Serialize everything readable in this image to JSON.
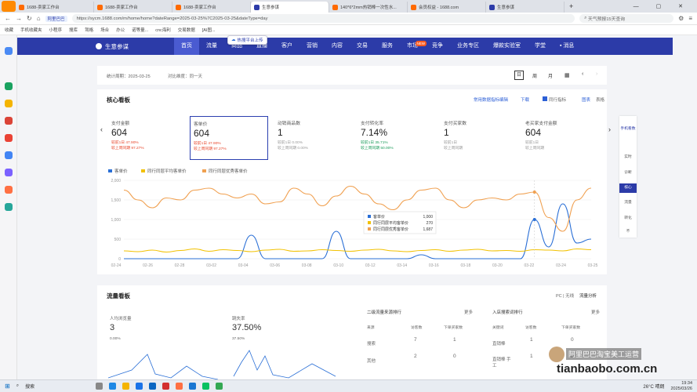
{
  "tabs": [
    {
      "label": "1688-卖家工作台",
      "color": "#ff6a00"
    },
    {
      "label": "1688-卖家工作台",
      "color": "#ff6a00"
    },
    {
      "label": "1688-卖家工作台",
      "color": "#ff6a00"
    },
    {
      "label": "生意参谋",
      "color": "#2c3ba8"
    },
    {
      "label": "140*6*2mm热销棒一次性水...",
      "color": "#ff6a00"
    },
    {
      "label": "会员权益 - 1688.com",
      "color": "#ff6a00"
    },
    {
      "label": "生意参谋",
      "color": "#2c3ba8"
    }
  ],
  "browser": {
    "url": "https://sycm.1688.com/m/home/home?dateRange=2025-03-25%7C2025-03-25&dateType=day",
    "search": "天气预报15天查询"
  },
  "bookmarks": [
    "收藏",
    "手机收藏夹",
    "小程序",
    "搜库",
    "驾格",
    "场合",
    "办公",
    "诺等量...",
    "cnc海利",
    "交易数据",
    "[AI图..."
  ],
  "appnav": {
    "brand": "生意参谋",
    "items": [
      "首页",
      "流量",
      "商品",
      "直播",
      "客户",
      "营销",
      "内容",
      "交易",
      "服务",
      "市场",
      "竞争",
      "业务专区",
      "爆款实验室",
      "学堂"
    ],
    "market_badge": "NEW",
    "msg": "消息"
  },
  "tooltip": "热搜平台上传",
  "filter": {
    "period": "统计周期：2025-03-25",
    "compare": "对比维度：同一天",
    "btns": [
      "日",
      "周",
      "月"
    ]
  },
  "core": {
    "title": "核心看板",
    "links": [
      "常用数据指标编辑",
      "下载",
      "同行指标",
      "图表",
      "表格"
    ],
    "metrics": [
      {
        "label": "支付金额",
        "value": "604",
        "l1": "较前1日 47.90%",
        "l2": "较上周同期 97.27%"
      },
      {
        "label": "客单价",
        "value": "604",
        "l1": "较前1日 47.90%",
        "l2": "较上周同期 97.27%"
      },
      {
        "label": "动销商品数",
        "value": "1",
        "l1": "较前1日 0.00%",
        "l2": "较上周同期 0.00%"
      },
      {
        "label": "支付转化率",
        "value": "7.14%",
        "l1": "较前1日 35.71%",
        "l2": "较上周同期 50.00%"
      },
      {
        "label": "支付买家数",
        "value": "1",
        "l1": "较前1日",
        "l2": "较上周同期"
      },
      {
        "label": "老买家支付金额",
        "value": "604",
        "l1": "较前1日",
        "l2": "较上周同期"
      }
    ]
  },
  "chart_data": {
    "type": "line",
    "x": [
      "02-24",
      "02-26",
      "02-28",
      "03-02",
      "03-04",
      "03-06",
      "03-08",
      "03-10",
      "03-12",
      "03-14",
      "03-16",
      "03-18",
      "03-20",
      "03-22",
      "03-24",
      "03-25"
    ],
    "ylim": [
      0,
      2000
    ],
    "yticks": [
      "0",
      "500",
      "1,000",
      "1,500",
      "2,000"
    ],
    "series": [
      {
        "name": "客单价",
        "color": "#2a6fd6",
        "values": [
          0,
          0,
          0,
          0,
          0,
          0,
          0,
          0,
          0,
          600,
          0,
          0,
          0,
          0,
          0,
          700,
          0,
          0,
          0,
          0,
          0,
          100,
          0,
          0,
          0,
          0,
          0,
          0,
          0,
          1000,
          300,
          1400,
          400,
          500
        ]
      },
      {
        "name": "同行同层平均客单价",
        "color": "#f2c100",
        "values": [
          200,
          180,
          220,
          170,
          210,
          250,
          190,
          230,
          210,
          180,
          220,
          240,
          190,
          200,
          230,
          210,
          190,
          220,
          240,
          200,
          180,
          210,
          230,
          190,
          220,
          240,
          200,
          210,
          190,
          230,
          220,
          200,
          250,
          230
        ]
      },
      {
        "name": "同行同层优秀客单价",
        "color": "#f0a050",
        "values": [
          1750,
          1500,
          1300,
          1550,
          1500,
          1750,
          1800,
          1650,
          1550,
          1650,
          1400,
          1450,
          1800,
          1650,
          1350,
          1600,
          1850,
          1650,
          1400,
          1250,
          1500,
          1750,
          1800,
          1500,
          1300,
          1500,
          1550,
          1500,
          1650,
          1700,
          1050,
          700,
          1500,
          1800
        ]
      }
    ],
    "tooltip": [
      {
        "name": "客单价",
        "value": "1,000"
      },
      {
        "name": "同行同层平均客单价",
        "value": "270"
      },
      {
        "name": "同行同层优秀客单价",
        "value": "1,687"
      }
    ]
  },
  "flow": {
    "title": "流量看板",
    "pc": "PC | 无线",
    "analysis": "流量分析",
    "m1": {
      "label": "人均浏览量",
      "value": "3",
      "sub": "0.00%"
    },
    "m2": {
      "label": "跳失率",
      "value": "37.50%",
      "sub": "37.50%"
    },
    "t1": {
      "title": "二级流量来源排行",
      "more": "更多",
      "cols": [
        "来源",
        "访客数",
        "下单买家数"
      ],
      "rows": [
        [
          "搜索",
          "7",
          "1"
        ],
        [
          "其他",
          "2",
          "0"
        ]
      ]
    },
    "t2": {
      "title": "入店搜索词排行",
      "more": "更多",
      "cols": [
        "关键词",
        "访客数",
        "下单买家数"
      ],
      "rows": [
        [
          "直销棒",
          "1",
          "0"
        ],
        [
          "直销棒 手工",
          "1",
          "0"
        ]
      ]
    }
  },
  "rightpanel": [
    "手机看数",
    "实时",
    "诊断",
    "核心",
    "流量",
    "转化",
    "不"
  ],
  "taskbar": {
    "search": "搜索",
    "weather": "26°C 晴朗",
    "time": "19:34",
    "date": "2025/03/26"
  },
  "watermark": {
    "line1": "阿里巴巴淘宝美工运营",
    "line2": "tianbaobo.com.cn"
  }
}
